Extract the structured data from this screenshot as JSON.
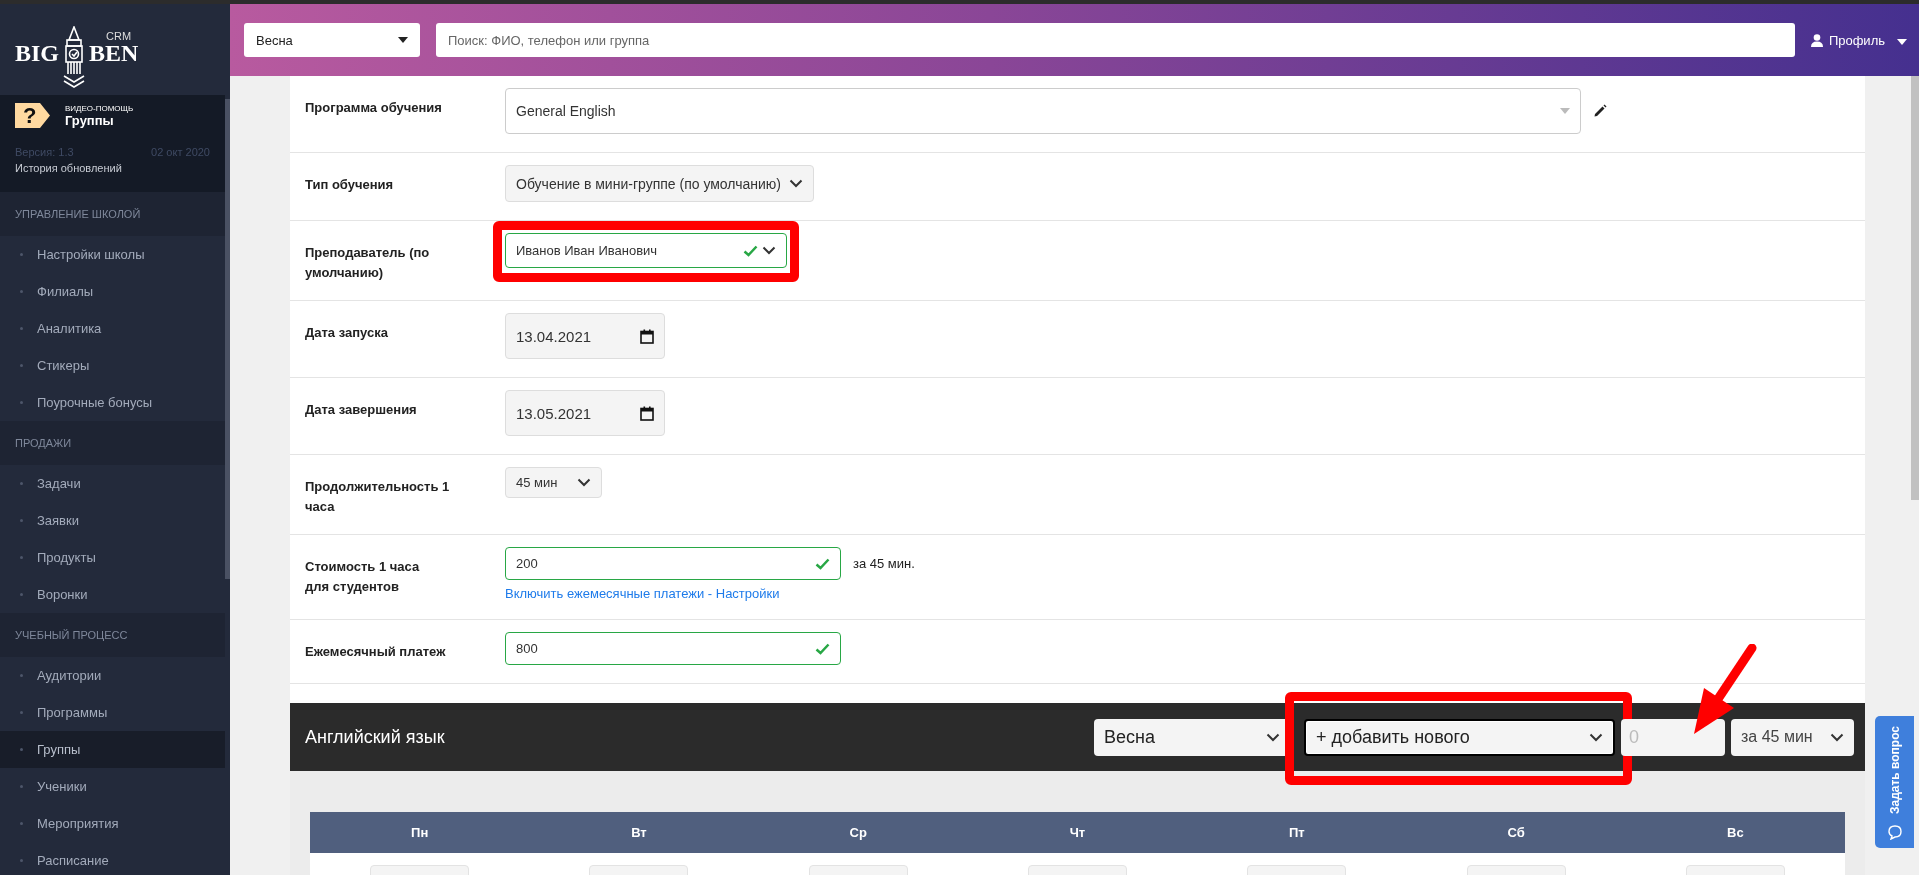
{
  "sidebar": {
    "logo": {
      "left": "BIG",
      "right": "BEN",
      "badge": "CRM"
    },
    "help": {
      "glyph": "?",
      "caption": "ВИДЕО-ПОМОЩЬ",
      "title": "Группы",
      "version": "Версия: 1.3",
      "date": "02 окт 2020",
      "history": "История обновлений"
    },
    "sections": [
      {
        "title": "УПРАВЛЕНИЕ ШКОЛОЙ",
        "items": [
          {
            "label": "Настройки школы",
            "selected": false
          },
          {
            "label": "Филиалы",
            "selected": false
          },
          {
            "label": "Аналитика",
            "selected": false
          },
          {
            "label": "Стикеры",
            "selected": false
          },
          {
            "label": "Поурочные бонусы",
            "selected": false
          }
        ]
      },
      {
        "title": "ПРОДАЖИ",
        "items": [
          {
            "label": "Задачи",
            "selected": false
          },
          {
            "label": "Заявки",
            "selected": false
          },
          {
            "label": "Продукты",
            "selected": false
          },
          {
            "label": "Воронки",
            "selected": false
          }
        ]
      },
      {
        "title": "УЧЕБНЫЙ ПРОЦЕСС",
        "items": [
          {
            "label": "Аудитории",
            "selected": false
          },
          {
            "label": "Программы",
            "selected": false
          },
          {
            "label": "Группы",
            "selected": true
          },
          {
            "label": "Ученики",
            "selected": false
          },
          {
            "label": "Мероприятия",
            "selected": false
          },
          {
            "label": "Расписание",
            "selected": false
          }
        ]
      }
    ]
  },
  "topbar": {
    "season": "Весна",
    "search_placeholder": "Поиск: ФИО, телефон или группа",
    "profile": "Профиль"
  },
  "form": {
    "rows": [
      {
        "label": "Программа обучения",
        "kind": "combo",
        "value": "General English",
        "editable": true
      },
      {
        "label": "Тип обучения",
        "kind": "select",
        "value": "Обучение в мини-группе (по умолчанию)"
      },
      {
        "label": "Преподаватель (по умолчанию)",
        "kind": "select",
        "value": "Иванов Иван Иванович",
        "valid": true,
        "highlighted": true
      },
      {
        "label": "Дата запуска",
        "kind": "date",
        "value": "13.04.2021"
      },
      {
        "label": "Дата завершения",
        "kind": "date",
        "value": "13.05.2021"
      },
      {
        "label": "Продолжительность 1 часа",
        "kind": "small-select",
        "value": "45 мин"
      },
      {
        "label": "Стоимость 1 часа\nдля студентов",
        "kind": "input",
        "value": "200",
        "valid": true,
        "suffix": "за 45 мин.",
        "link": "Включить ежемесячные платежи - Настройки"
      },
      {
        "label": "Ежемесячный платеж",
        "kind": "input",
        "value": "800",
        "valid": true
      }
    ]
  },
  "schedule": {
    "title": "Английский язык",
    "season": "Весна",
    "teacher": "+ добавить нового",
    "teacher_highlighted": true,
    "price": "0",
    "duration": "за 45 мин",
    "arrow": true,
    "days": [
      "Пн",
      "Вт",
      "Ср",
      "Чт",
      "Пт",
      "Сб",
      "Вс"
    ]
  },
  "ask_tab": {
    "label": "Задать вопрос"
  }
}
